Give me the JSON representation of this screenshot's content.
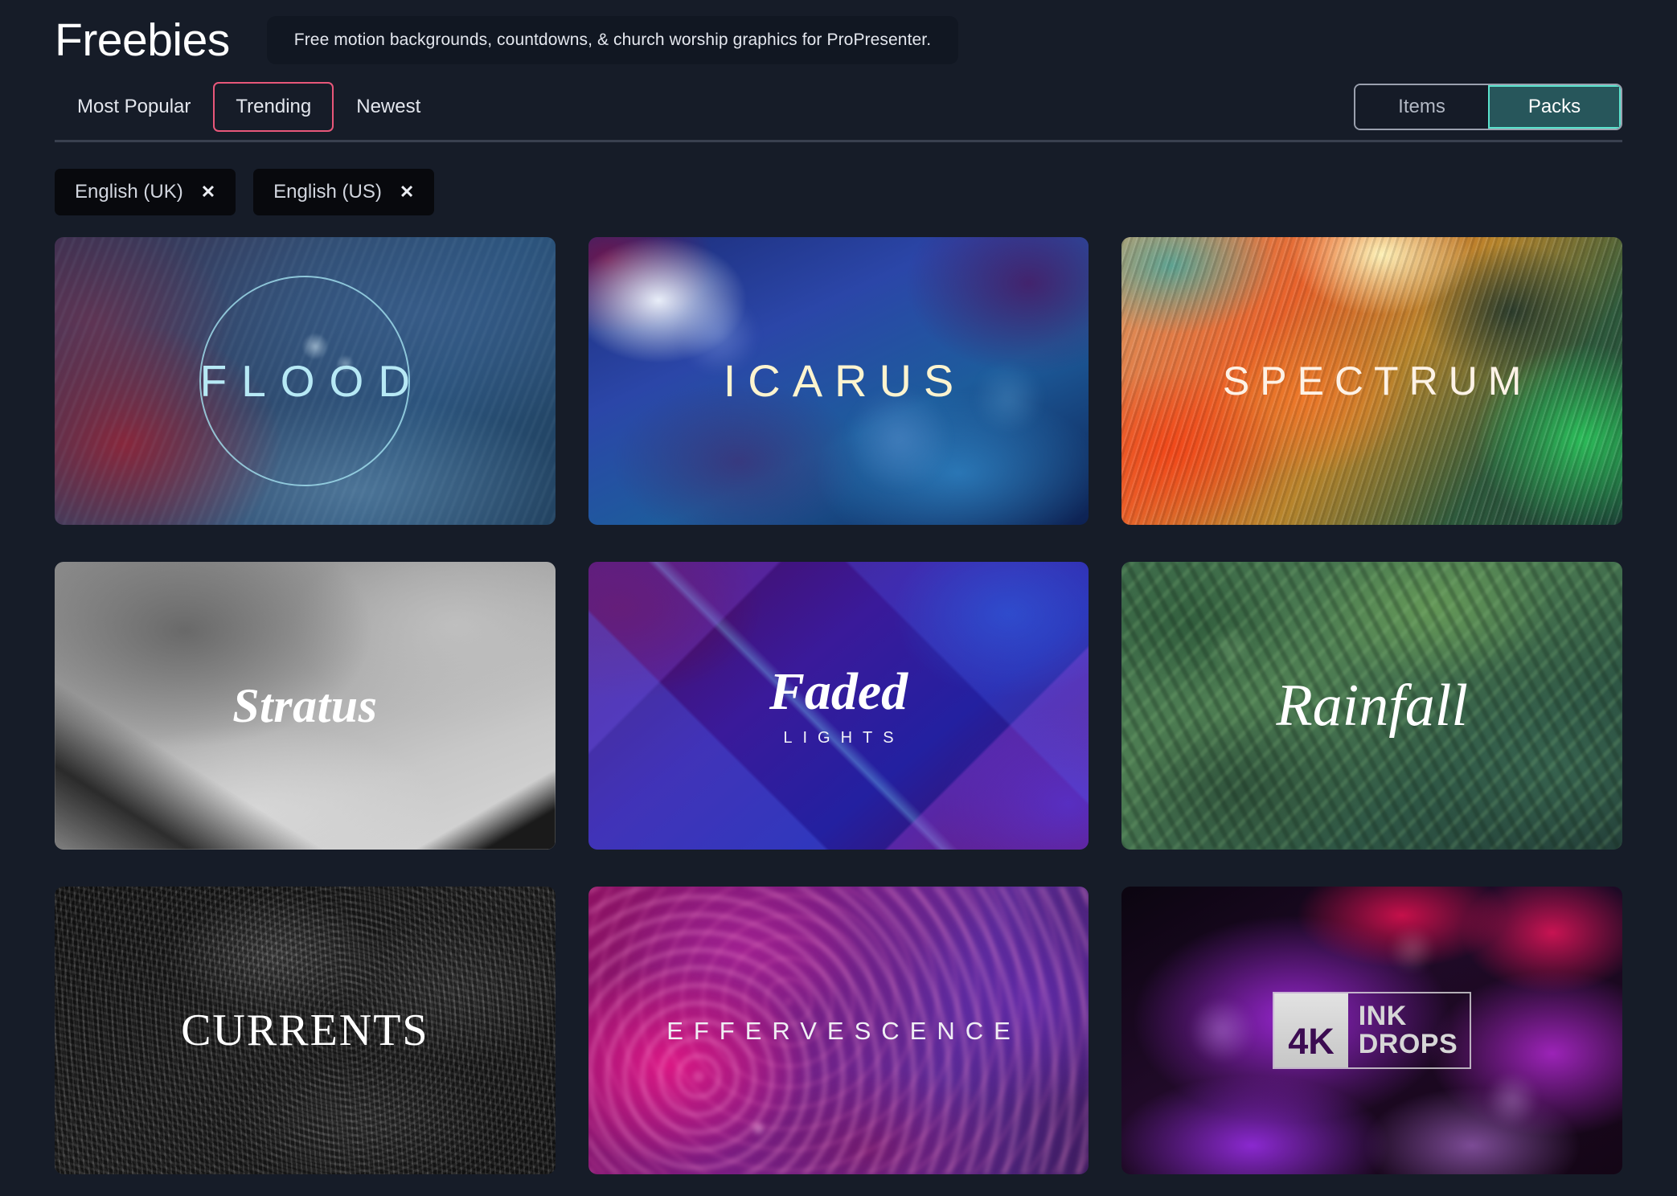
{
  "header": {
    "title": "Freebies",
    "tagline": "Free motion backgrounds, countdowns, & church worship graphics for ProPresenter."
  },
  "sort_tabs": {
    "items": [
      {
        "label": "Most Popular",
        "active": false
      },
      {
        "label": "Trending",
        "active": true
      },
      {
        "label": "Newest",
        "active": false
      }
    ],
    "active_border_color": "#e8577a"
  },
  "view_toggle": {
    "options": [
      {
        "label": "Items",
        "active": false
      },
      {
        "label": "Packs",
        "active": true
      }
    ],
    "active_bg": "#27565b",
    "active_border": "#5ae3cd"
  },
  "filters": {
    "chips": [
      {
        "label": "English (UK)",
        "remove_icon": "✕"
      },
      {
        "label": "English (US)",
        "remove_icon": "✕"
      }
    ]
  },
  "grid": {
    "cards": [
      {
        "title": "FLOOD"
      },
      {
        "title": "ICARUS"
      },
      {
        "title": "SPECTRUM"
      },
      {
        "title": "Stratus"
      },
      {
        "title": "Faded",
        "subtitle": "LIGHTS"
      },
      {
        "title": "Rainfall"
      },
      {
        "title": "CURRENTS"
      },
      {
        "title": "EFFERVESCENCE"
      },
      {
        "title": "INK DROPS",
        "badge_resolution": "4K",
        "badge_line1": "INK",
        "badge_line2": "DROPS"
      }
    ]
  },
  "theme": {
    "page_bg": "#161c28",
    "pill_bg": "#111722",
    "chip_bg": "#08090d",
    "divider": "#39404f"
  }
}
